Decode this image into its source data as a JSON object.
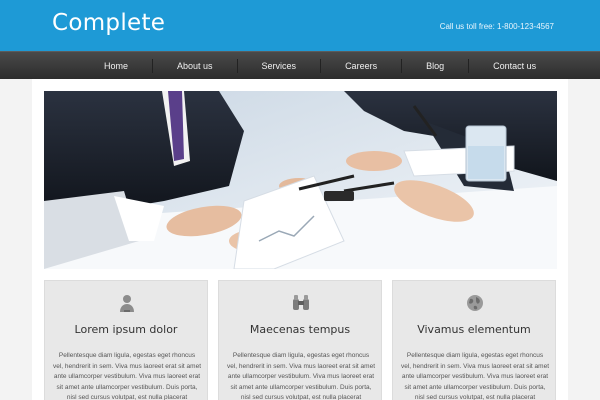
{
  "header": {
    "logo": "Complete",
    "phone": "Call us toll free: 1-800-123-4567"
  },
  "nav": {
    "items": [
      "Home",
      "About us",
      "Services",
      "Careers",
      "Blog",
      "Contact us"
    ]
  },
  "hero": {
    "icon": "business-meeting-photo"
  },
  "cards": [
    {
      "icon": "user-icon",
      "title": "Lorem ipsum dolor",
      "text": "Pellentesque diam ligula, egestas eget rhoncus vel, hendrerit in sem. Viva mus laoreet erat sit amet ante ullamcorper vestibulum. Viva mus laoreet erat sit amet ante ullamcorper vestibulum. Duis porta, nisl sed cursus volutpat, est nulla placerat"
    },
    {
      "icon": "binoculars-icon",
      "title": "Maecenas tempus",
      "text": "Pellentesque diam ligula, egestas eget rhoncus vel, hendrerit in sem. Viva mus laoreet erat sit amet ante ullamcorper vestibulum. Viva mus laoreet erat sit amet ante ullamcorper vestibulum. Duis porta, nisl sed cursus volutpat, est nulla placerat"
    },
    {
      "icon": "globe-icon",
      "title": "Vivamus elementum",
      "text": "Pellentesque diam ligula, egestas eget rhoncus vel, hendrerit in sem. Viva mus laoreet erat sit amet ante ullamcorper vestibulum. Viva mus laoreet erat sit amet ante ullamcorper vestibulum. Duis porta, nisl sed cursus volutpat, est nulla placerat"
    }
  ],
  "colors": {
    "header_bg": "#1e9ad6",
    "nav_bg": "#333333",
    "card_bg": "#e8e8e8"
  }
}
